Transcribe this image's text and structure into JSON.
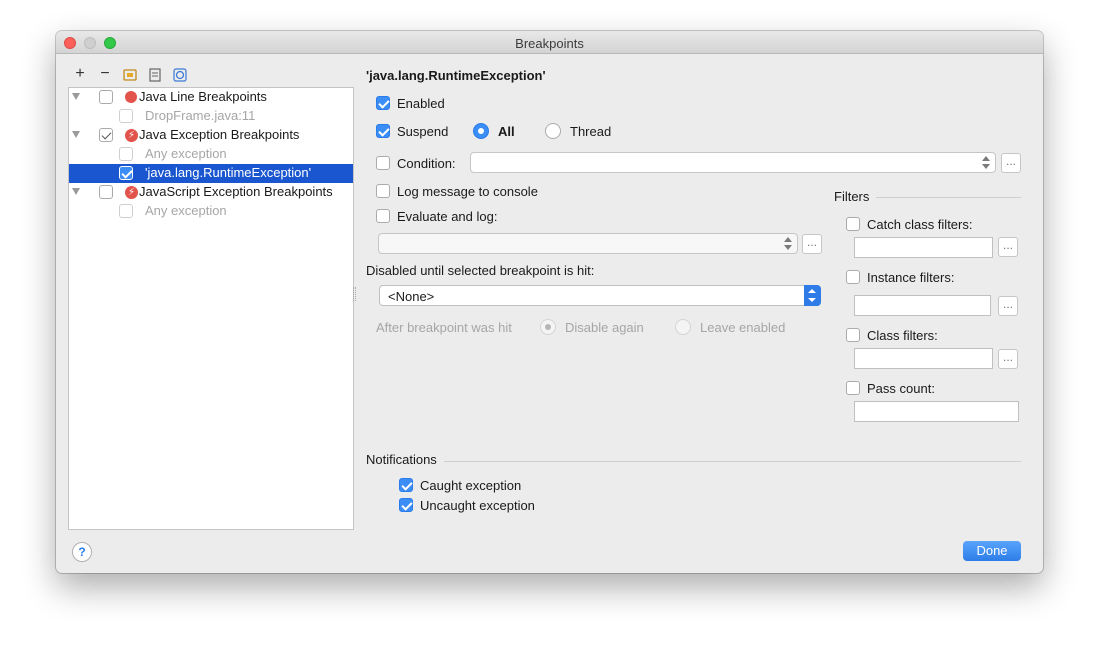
{
  "window": {
    "title": "Breakpoints"
  },
  "toolbar": {
    "add": "+",
    "remove": "−"
  },
  "tree": {
    "groups": [
      {
        "label": "Java Line Breakpoints",
        "children": [
          {
            "label": "DropFrame.java:11"
          }
        ]
      },
      {
        "label": "Java Exception Breakpoints",
        "children": [
          {
            "label": "Any exception"
          },
          {
            "label": "'java.lang.RuntimeException'"
          }
        ]
      },
      {
        "label": "JavaScript Exception Breakpoints",
        "children": [
          {
            "label": "Any exception"
          }
        ]
      }
    ]
  },
  "detail": {
    "title": "'java.lang.RuntimeException'",
    "enabled": "Enabled",
    "suspend": "Suspend",
    "all": "All",
    "thread": "Thread",
    "condition": "Condition:",
    "log_message": "Log message to console",
    "evaluate": "Evaluate and log:",
    "disabled_until": "Disabled until selected breakpoint is hit:",
    "none_option": "<None>",
    "after_hit": "After breakpoint was hit",
    "disable_again": "Disable again",
    "leave_enabled": "Leave enabled"
  },
  "filters": {
    "title": "Filters",
    "catch_class": "Catch class filters:",
    "instance": "Instance filters:",
    "class": "Class filters:",
    "pass_count": "Pass count:"
  },
  "notifications": {
    "title": "Notifications",
    "caught": "Caught exception",
    "uncaught": "Uncaught exception"
  },
  "buttons": {
    "help": "?",
    "done": "Done",
    "ellipsis": "..."
  },
  "colors": {
    "accent": "#3b8ef6",
    "selection": "#1a56cf",
    "breakpoint": "#e2544b"
  }
}
